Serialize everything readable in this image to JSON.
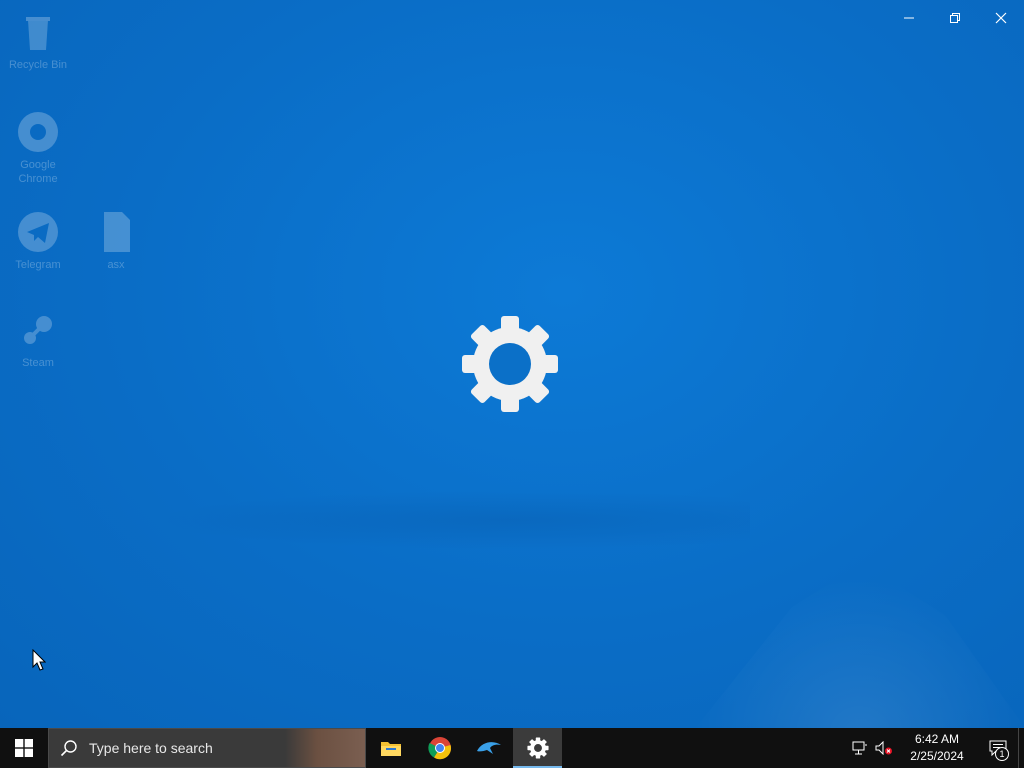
{
  "desktop": {
    "icons": [
      {
        "label": "Recycle Bin",
        "icon": "recycle-bin-icon"
      },
      {
        "label": "Google Chrome",
        "icon": "chrome-icon"
      },
      {
        "label": "Telegram",
        "icon": "telegram-icon"
      },
      {
        "label": "asx",
        "icon": "file-icon"
      },
      {
        "label": "Steam",
        "icon": "steam-icon"
      }
    ]
  },
  "splash": {
    "app": "Settings",
    "icon": "gear-icon",
    "background_color": "#0a6cc4"
  },
  "window_controls": {
    "minimize": "minimize-icon",
    "restore": "restore-icon",
    "close": "close-icon"
  },
  "taskbar": {
    "search_placeholder": "Type here to search",
    "apps": [
      {
        "name": "File Explorer",
        "icon": "folder-icon"
      },
      {
        "name": "Google Chrome",
        "icon": "chrome-icon"
      },
      {
        "name": "Dolphin",
        "icon": "dolphin-icon"
      },
      {
        "name": "Settings",
        "icon": "gear-icon",
        "active": true
      }
    ],
    "tray": {
      "time": "6:42 AM",
      "date": "2/25/2024",
      "notification_count": "1"
    }
  }
}
